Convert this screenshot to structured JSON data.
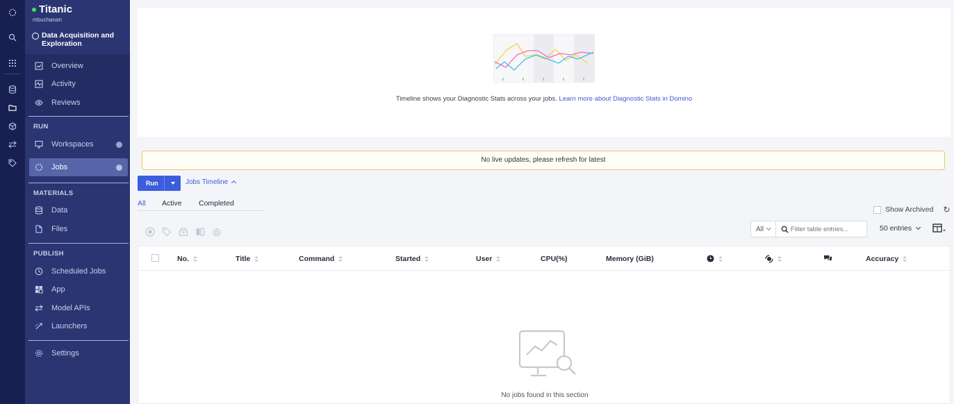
{
  "project": {
    "name": "Titanic",
    "owner": "mbuchanan",
    "stage": "Data Acquisition and Exploration"
  },
  "sidebar": {
    "top_items": [
      {
        "label": "Overview",
        "icon": "overview-icon"
      },
      {
        "label": "Activity",
        "icon": "activity-icon"
      },
      {
        "label": "Reviews",
        "icon": "reviews-icon"
      }
    ],
    "run_section": "RUN",
    "run_items": [
      {
        "label": "Workspaces",
        "icon": "workspaces-icon"
      },
      {
        "label": "Jobs",
        "icon": "jobs-icon"
      }
    ],
    "materials_section": "MATERIALS",
    "materials_items": [
      {
        "label": "Data",
        "icon": "data-icon"
      },
      {
        "label": "Files",
        "icon": "files-icon"
      }
    ],
    "publish_section": "PUBLISH",
    "publish_items": [
      {
        "label": "Scheduled Jobs",
        "icon": "clock-icon"
      },
      {
        "label": "App",
        "icon": "app-icon"
      },
      {
        "label": "Model APIs",
        "icon": "model-apis-icon"
      },
      {
        "label": "Launchers",
        "icon": "launchers-icon"
      }
    ],
    "settings_label": "Settings"
  },
  "timeline": {
    "text": "Timeline shows your Diagnostic Stats across your jobs.",
    "link": "Learn more about Diagnostic Stats in Domino"
  },
  "banner": "No live updates, please refresh for latest",
  "toolbar": {
    "run_label": "Run",
    "timeline_toggle": "Jobs Timeline"
  },
  "tabs": [
    "All",
    "Active",
    "Completed"
  ],
  "show_archived": "Show Archived",
  "filter": {
    "scope": "All",
    "placeholder": "Filter table entries..."
  },
  "entries_label": "50 entries",
  "table": {
    "columns": [
      "No.",
      "Title",
      "Command",
      "Started",
      "User",
      "CPU(%)",
      "Memory (GiB)",
      "Accuracy"
    ],
    "rows": [],
    "empty_message": "No jobs found in this section"
  },
  "colors": {
    "rail": "#172051",
    "sidebar": "#2b3572",
    "accent": "#3c5ddc",
    "active_nav": "#5565a8",
    "status_dot": "#4cd964"
  }
}
